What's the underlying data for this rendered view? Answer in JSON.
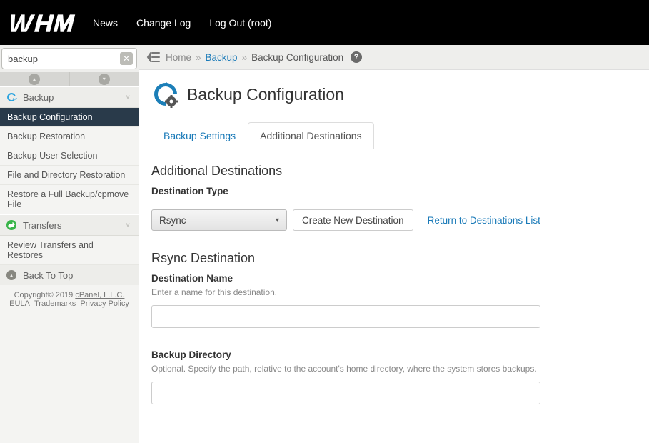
{
  "topbar": {
    "nav": [
      "News",
      "Change Log",
      "Log Out (root)"
    ]
  },
  "sidebar": {
    "search_value": "backup",
    "groups": [
      {
        "name": "Backup",
        "items": [
          {
            "label": "Backup Configuration",
            "active": true
          },
          {
            "label": "Backup Restoration"
          },
          {
            "label": "Backup User Selection"
          },
          {
            "label": "File and Directory Restoration"
          },
          {
            "label": "Restore a Full Backup/cpmove File"
          }
        ]
      },
      {
        "name": "Transfers",
        "items": [
          {
            "label": "Review Transfers and Restores"
          }
        ]
      }
    ],
    "back_top": "Back To Top"
  },
  "footer": {
    "copyright": "Copyright© 2019 ",
    "company": "cPanel, L.L.C.",
    "links": [
      "EULA",
      "Trademarks",
      "Privacy Policy"
    ]
  },
  "breadcrumb": {
    "home": "Home",
    "backup": "Backup",
    "current": "Backup Configuration"
  },
  "page": {
    "title": "Backup Configuration",
    "tabs": [
      {
        "label": "Backup Settings",
        "active": false
      },
      {
        "label": "Additional Destinations",
        "active": true
      }
    ],
    "section_title": "Additional Destinations",
    "dest_type_label": "Destination Type",
    "select_value": "Rsync",
    "create_btn": "Create New Destination",
    "return_link": "Return to Destinations List",
    "rsync_section": "Rsync Destination",
    "dest_name_label": "Destination Name",
    "dest_name_help": "Enter a name for this destination.",
    "dest_name_value": "",
    "backup_dir_label": "Backup Directory",
    "backup_dir_help": "Optional. Specify the path, relative to the account's home directory, where the system stores backups.",
    "backup_dir_value": ""
  }
}
